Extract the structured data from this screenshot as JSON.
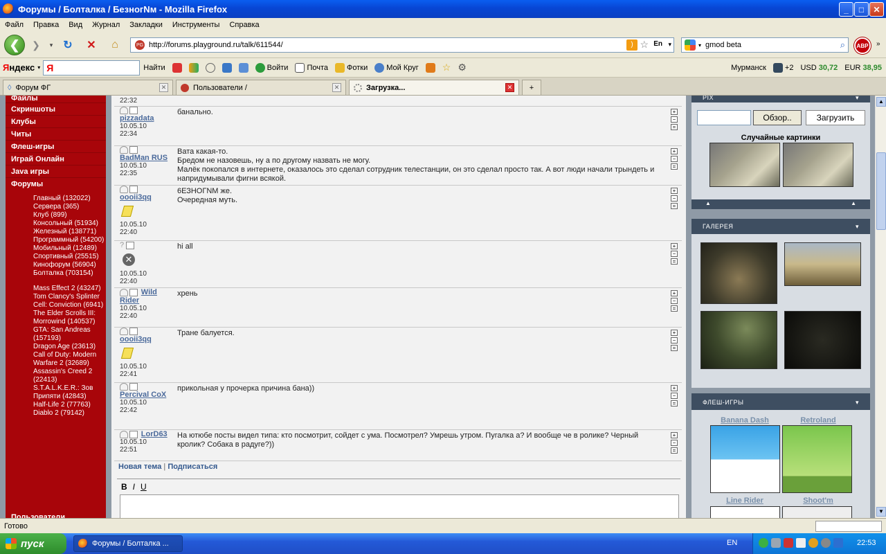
{
  "window": {
    "title": "Форумы / Болталка / БезногNм - Mozilla Firefox"
  },
  "menu": [
    "Файл",
    "Правка",
    "Вид",
    "Журнал",
    "Закладки",
    "Инструменты",
    "Справка"
  ],
  "nav": {
    "url": "http://forums.playground.ru/talk/611544/",
    "search_value": "gmod beta",
    "lang_badge": "En",
    "abp_label": "ABP"
  },
  "yandex": {
    "logo_prefix": "Я",
    "logo_rest": "ндекс",
    "input_glyph": "Я",
    "find": "Найти",
    "login": "Войти",
    "mail": "Почта",
    "photos": "Фотки",
    "circle": "Мой Круг",
    "city": "Мурманск",
    "temp": "+2",
    "usd_label": "USD",
    "usd": "30,72",
    "eur_label": "EUR",
    "eur": "38,95"
  },
  "tabs": [
    {
      "label": "Форум ФГ"
    },
    {
      "label": "Пользователи /"
    },
    {
      "label": "Загрузка..."
    }
  ],
  "leftnav": {
    "main": [
      "Файлы",
      "Скриншоты",
      "Клубы",
      "Читы",
      "Флеш-игры",
      "Играй Онлайн",
      "Java игры",
      "Форумы"
    ],
    "forums": [
      "Главный (132022)",
      "Сервера (365)",
      "Клуб (899)",
      "Консольный (51934)",
      "Железный (138771)",
      "Программный (54200)",
      "Мобильный (12489)",
      "Спортивный (25515)",
      "Кинофорум (56904)",
      "Болталка (703154)"
    ],
    "games": [
      "Mass Effect 2 (43247)",
      "Tom Clancy's Splinter Cell: Conviction (6941)",
      "The Elder Scrolls III: Morrowind (140537)",
      "GTA: San Andreas (157193)",
      "Dragon Age (23613)",
      "Call of Duty: Modern Warfare 2 (32689)",
      "Assassin's Creed 2 (22413)",
      "S.T.A.L.K.E.R.: Зов Припяти (42843)",
      "Half-Life 2 (77763)",
      "Diablo 2 (79142)"
    ],
    "bottom": "Пользователи"
  },
  "posts": [
    {
      "user": "",
      "date": "",
      "time": "22:32",
      "msg": ""
    },
    {
      "user": "pizzadata",
      "date": "10.05.10",
      "time": "22:34",
      "msg": "банально."
    },
    {
      "user": "BadMan RUS",
      "date": "10.05.10",
      "time": "22:35",
      "msg": "Вата какая-то.\nБредом не назовешь, ну а по другому назвать не могу.\nМалёк покопался в интернете, оказалось это сделал сотрудник телестанции, он это сделал просто так. А вот люди начали трындеть и напридумывали фигни всякой."
    },
    {
      "user": "oooii3qq",
      "date": "10.05.10",
      "time": "22:40",
      "msg": "6ЕЗНОГNМ же.\nОчередная муть."
    },
    {
      "user": "",
      "date": "10.05.10",
      "time": "22:40",
      "msg": "hi all"
    },
    {
      "user": "Wild Rider",
      "date": "10.05.10",
      "time": "22:40",
      "msg": "хрень"
    },
    {
      "user": "oooii3qq",
      "date": "10.05.10",
      "time": "22:41",
      "msg": "Тране балуется."
    },
    {
      "user": "Percival CoX",
      "date": "10.05.10",
      "time": "22:42",
      "msg": "прикольная у прочерка причина бана))"
    },
    {
      "user": "LorD63",
      "date": "10.05.10",
      "time": "22:51",
      "msg": "На ютюбе посты видел типа: кто посмотрит, сойдет с ума. Посмотрел? Умрешь утром. Пугалка а? И вообще че в ролике? Черный кролик? Собака в радуге?))"
    }
  ],
  "forum_links": {
    "new_topic": "Новая тема",
    "sep": "|",
    "subscribe": "Подписаться"
  },
  "editor": {
    "bold": "B",
    "italic": "I",
    "underline": "U"
  },
  "right": {
    "pix_title": "PIX",
    "browse": "Обзор..",
    "upload": "Загрузить",
    "random": "Случайные картинки",
    "gallery_title": "ГАЛЕРЕЯ",
    "flash_title": "ФЛЕШ-ИГРЫ",
    "flash_games": [
      "Banana Dash",
      "Retroland",
      "Line Rider",
      "Shoot'm"
    ]
  },
  "status": {
    "text": "Готово"
  },
  "taskbar": {
    "start": "пуск",
    "task": "Форумы / Болталка ...",
    "lang": "EN",
    "clock": "22:53"
  },
  "colors": {
    "nav_red": "#a8050a",
    "panel_head": "#3e4e61",
    "user_link": "#4b6a9b"
  }
}
